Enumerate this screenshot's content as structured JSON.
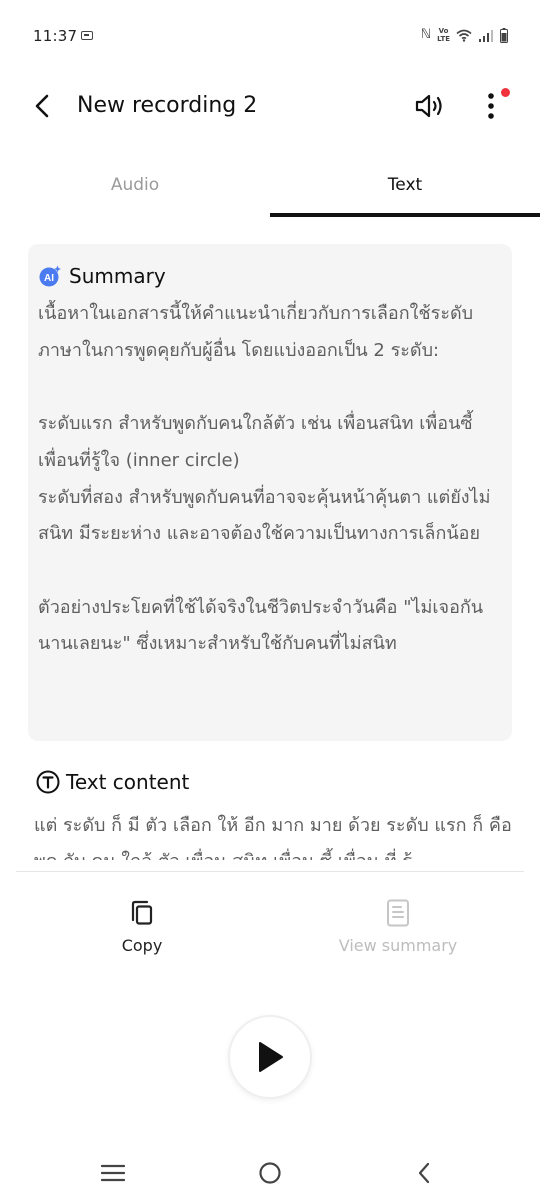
{
  "status_bar": {
    "time": "11:37",
    "nfc_glyph": "ℕ",
    "network_top": "Vo",
    "network_bottom": "LTE",
    "icons": [
      "notification-icon",
      "nfc-icon",
      "volte-icon",
      "wifi-icon",
      "signal-icon",
      "battery-icon"
    ]
  },
  "header": {
    "title": "New recording 2",
    "icons": [
      "back-arrow-icon",
      "speaker-icon",
      "more-vert-icon"
    ],
    "badge_color": "#f0323c"
  },
  "tabs": [
    {
      "label": "Audio",
      "active": false
    },
    {
      "label": "Text",
      "active": true
    }
  ],
  "summary": {
    "title": "Summary",
    "icon": "ai-sparkle-icon",
    "icon_color": "#4a7bf0",
    "body": "เนื้อหาในเอกสารนี้ให้คำแนะนำเกี่ยวกับการเลือกใช้ระดับภาษาในการพูดคุยกับผู้อื่น โดยแบ่งออกเป็น 2 ระดับ:\n\nระดับแรก สำหรับพูดกับคนใกล้ตัว เช่น เพื่อนสนิท เพื่อนซี้ เพื่อนที่รู้ใจ (inner circle)\nระดับที่สอง สำหรับพูดกับคนที่อาจจะคุ้นหน้าคุ้นตา แต่ยังไม่สนิท มีระยะห่าง และอาจต้องใช้ความเป็นทางการเล็กน้อย\n\nตัวอย่างประโยคที่ใช้ได้จริงในชีวิตประจำวันคือ \"ไม่เจอกันนานเลยนะ\" ซึ่งเหมาะสำหรับใช้กับคนที่ไม่สนิท"
  },
  "text_content": {
    "title": "Text content",
    "icon": "text-t-circle-icon",
    "body": "แต่ ระดับ ก็ มี ตัว เลือก ให้ อีก มาก มาย ด้วย ระดับ แรก ก็ คือ พูด กับ คน ใกล้ ตัว เพื่อน สนิท เพื่อน ซี้ เพื่อน ที่ รู้"
  },
  "actions": {
    "copy": {
      "label": "Copy",
      "icon": "copy-icon"
    },
    "view_summary": {
      "label": "View summary",
      "icon": "document-icon",
      "enabled": false
    }
  },
  "player": {
    "icon": "play-icon"
  },
  "nav_bar": {
    "icons": [
      "recents-icon",
      "home-icon",
      "nav-back-icon"
    ]
  }
}
